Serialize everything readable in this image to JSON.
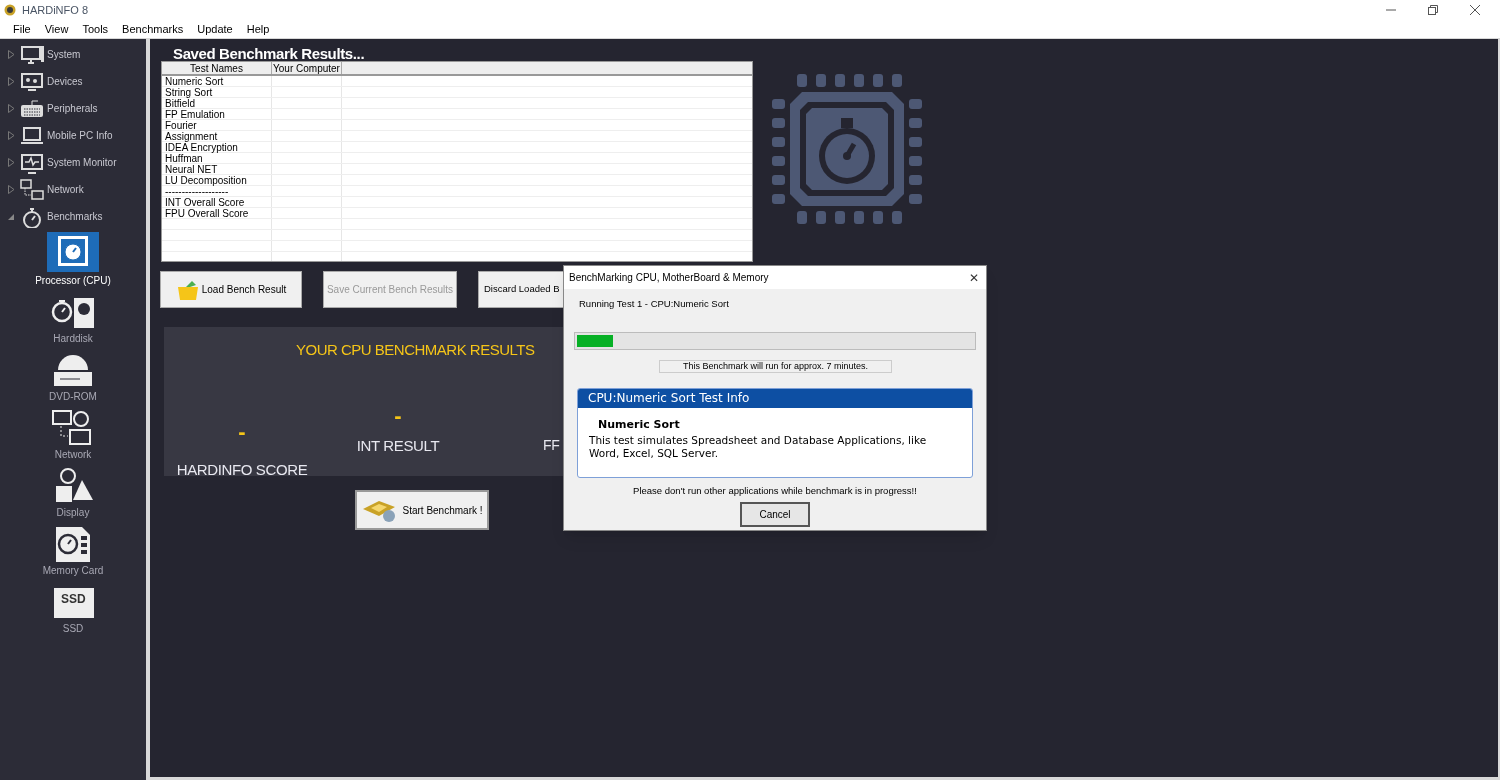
{
  "window": {
    "title": "HARDiNFO 8"
  },
  "menu": [
    "File",
    "View",
    "Tools",
    "Benchmarks",
    "Update",
    "Help"
  ],
  "sidebar": {
    "items": [
      {
        "label": "System",
        "expanded": false
      },
      {
        "label": "Devices",
        "expanded": false
      },
      {
        "label": "Peripherals",
        "expanded": false
      },
      {
        "label": "Mobile PC Info",
        "expanded": false
      },
      {
        "label": "System Monitor",
        "expanded": false
      },
      {
        "label": "Network",
        "expanded": false
      },
      {
        "label": "Benchmarks",
        "expanded": true,
        "children": [
          {
            "label": "Processor (CPU)",
            "selected": true
          },
          {
            "label": "Harddisk",
            "selected": false
          },
          {
            "label": "DVD-ROM",
            "selected": false
          },
          {
            "label": "Network",
            "selected": false
          },
          {
            "label": "Display",
            "selected": false
          },
          {
            "label": "Memory Card",
            "selected": false
          },
          {
            "label": "SSD",
            "selected": false,
            "icon_text": "SSD"
          }
        ]
      }
    ]
  },
  "saved_results": {
    "title": "Saved Benchmark Results...",
    "columns": [
      "Test Names",
      "Your Computer"
    ],
    "rows": [
      "Numeric Sort",
      "String Sort",
      "Bitfield",
      "FP Emulation",
      "Fourier",
      "Assignment",
      "IDEA Encryption",
      "Huffman",
      "Neural NET",
      "LU Decomposition",
      "-------------------",
      "INT Overall Score",
      "FPU Overall Score"
    ]
  },
  "buttons": [
    {
      "label": "Load Bench Result",
      "disabled": false
    },
    {
      "label": "Save Current Bench Results",
      "disabled": true
    },
    {
      "label": "Discard Loaded B",
      "disabled": false
    }
  ],
  "results": {
    "title": "YOUR CPU BENCHMARK RESULTS",
    "scores": [
      {
        "value": "-",
        "label": "HARDINFO SCORE"
      },
      {
        "value": "-",
        "label": "INT RESULT"
      },
      {
        "label": "FF"
      }
    ]
  },
  "start_button": "Start Benchmark !",
  "dialog": {
    "title": "BenchMarking CPU, MotherBoard & Memory",
    "close": "✕",
    "status": "Running Test 1 - CPU:Numeric Sort",
    "level": 0.09,
    "duration_note": "This Benchmark will run for approx. 7 minutes.",
    "info": {
      "header": "CPU:Numeric Sort Test Info",
      "test_name": "Numeric Sort",
      "description": "This test simulates Spreadsheet and Database Applications, like Word, Excel, SQL Server."
    },
    "warning": "Please don't run other applications while benchmark is in progress!!",
    "cancel": "Cancel"
  }
}
